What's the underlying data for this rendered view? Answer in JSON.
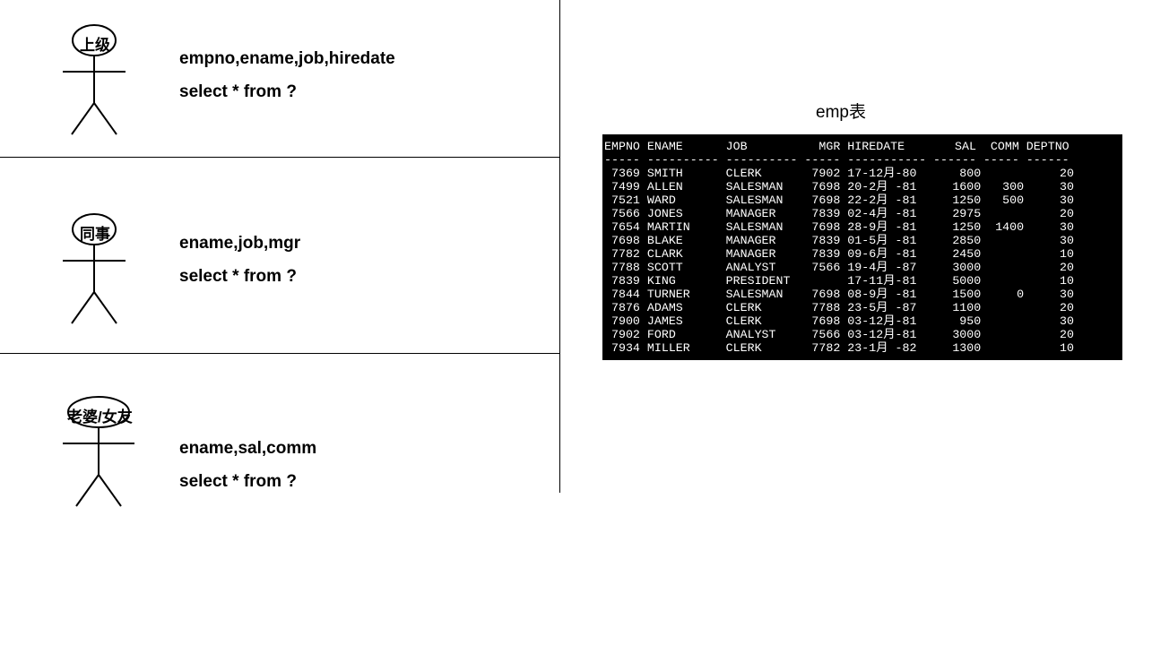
{
  "sections": [
    {
      "label": "上级",
      "line1": "empno,ename,job,hiredate",
      "line2": "select * from ?"
    },
    {
      "label": "同事",
      "line1": "ename,job,mgr",
      "line2": "select * from ?"
    },
    {
      "label": "老婆/女友",
      "line1": "ename,sal,comm",
      "line2": "select * from ?"
    }
  ],
  "emp_title": "emp表",
  "table": {
    "headers": [
      "EMPNO",
      "ENAME",
      "JOB",
      "MGR",
      "HIREDATE",
      "SAL",
      "COMM",
      "DEPTNO"
    ],
    "rows": [
      {
        "empno": "7369",
        "ename": "SMITH",
        "job": "CLERK",
        "mgr": "7902",
        "hiredate": "17-12月-80",
        "sal": "800",
        "comm": "",
        "deptno": "20"
      },
      {
        "empno": "7499",
        "ename": "ALLEN",
        "job": "SALESMAN",
        "mgr": "7698",
        "hiredate": "20-2月 -81",
        "sal": "1600",
        "comm": "300",
        "deptno": "30"
      },
      {
        "empno": "7521",
        "ename": "WARD",
        "job": "SALESMAN",
        "mgr": "7698",
        "hiredate": "22-2月 -81",
        "sal": "1250",
        "comm": "500",
        "deptno": "30"
      },
      {
        "empno": "7566",
        "ename": "JONES",
        "job": "MANAGER",
        "mgr": "7839",
        "hiredate": "02-4月 -81",
        "sal": "2975",
        "comm": "",
        "deptno": "20"
      },
      {
        "empno": "7654",
        "ename": "MARTIN",
        "job": "SALESMAN",
        "mgr": "7698",
        "hiredate": "28-9月 -81",
        "sal": "1250",
        "comm": "1400",
        "deptno": "30"
      },
      {
        "empno": "7698",
        "ename": "BLAKE",
        "job": "MANAGER",
        "mgr": "7839",
        "hiredate": "01-5月 -81",
        "sal": "2850",
        "comm": "",
        "deptno": "30"
      },
      {
        "empno": "7782",
        "ename": "CLARK",
        "job": "MANAGER",
        "mgr": "7839",
        "hiredate": "09-6月 -81",
        "sal": "2450",
        "comm": "",
        "deptno": "10"
      },
      {
        "empno": "7788",
        "ename": "SCOTT",
        "job": "ANALYST",
        "mgr": "7566",
        "hiredate": "19-4月 -87",
        "sal": "3000",
        "comm": "",
        "deptno": "20"
      },
      {
        "empno": "7839",
        "ename": "KING",
        "job": "PRESIDENT",
        "mgr": "",
        "hiredate": "17-11月-81",
        "sal": "5000",
        "comm": "",
        "deptno": "10"
      },
      {
        "empno": "7844",
        "ename": "TURNER",
        "job": "SALESMAN",
        "mgr": "7698",
        "hiredate": "08-9月 -81",
        "sal": "1500",
        "comm": "0",
        "deptno": "30"
      },
      {
        "empno": "7876",
        "ename": "ADAMS",
        "job": "CLERK",
        "mgr": "7788",
        "hiredate": "23-5月 -87",
        "sal": "1100",
        "comm": "",
        "deptno": "20"
      },
      {
        "empno": "7900",
        "ename": "JAMES",
        "job": "CLERK",
        "mgr": "7698",
        "hiredate": "03-12月-81",
        "sal": "950",
        "comm": "",
        "deptno": "30"
      },
      {
        "empno": "7902",
        "ename": "FORD",
        "job": "ANALYST",
        "mgr": "7566",
        "hiredate": "03-12月-81",
        "sal": "3000",
        "comm": "",
        "deptno": "20"
      },
      {
        "empno": "7934",
        "ename": "MILLER",
        "job": "CLERK",
        "mgr": "7782",
        "hiredate": "23-1月 -82",
        "sal": "1300",
        "comm": "",
        "deptno": "10"
      }
    ]
  },
  "chart_data": {
    "type": "table",
    "title": "emp表",
    "columns": [
      "EMPNO",
      "ENAME",
      "JOB",
      "MGR",
      "HIREDATE",
      "SAL",
      "COMM",
      "DEPTNO"
    ],
    "rows": [
      [
        7369,
        "SMITH",
        "CLERK",
        7902,
        "17-12月-80",
        800,
        null,
        20
      ],
      [
        7499,
        "ALLEN",
        "SALESMAN",
        7698,
        "20-2月 -81",
        1600,
        300,
        30
      ],
      [
        7521,
        "WARD",
        "SALESMAN",
        7698,
        "22-2月 -81",
        1250,
        500,
        30
      ],
      [
        7566,
        "JONES",
        "MANAGER",
        7839,
        "02-4月 -81",
        2975,
        null,
        20
      ],
      [
        7654,
        "MARTIN",
        "SALESMAN",
        7698,
        "28-9月 -81",
        1250,
        1400,
        30
      ],
      [
        7698,
        "BLAKE",
        "MANAGER",
        7839,
        "01-5月 -81",
        2850,
        null,
        30
      ],
      [
        7782,
        "CLARK",
        "MANAGER",
        7839,
        "09-6月 -81",
        2450,
        null,
        10
      ],
      [
        7788,
        "SCOTT",
        "ANALYST",
        7566,
        "19-4月 -87",
        3000,
        null,
        20
      ],
      [
        7839,
        "KING",
        "PRESIDENT",
        null,
        "17-11月-81",
        5000,
        null,
        10
      ],
      [
        7844,
        "TURNER",
        "SALESMAN",
        7698,
        "08-9月 -81",
        1500,
        0,
        30
      ],
      [
        7876,
        "ADAMS",
        "CLERK",
        7788,
        "23-5月 -87",
        1100,
        null,
        20
      ],
      [
        7900,
        "JAMES",
        "CLERK",
        7698,
        "03-12月-81",
        950,
        null,
        30
      ],
      [
        7902,
        "FORD",
        "ANALYST",
        7566,
        "03-12月-81",
        3000,
        null,
        20
      ],
      [
        7934,
        "MILLER",
        "CLERK",
        7782,
        "23-1月 -82",
        1300,
        null,
        10
      ]
    ]
  }
}
